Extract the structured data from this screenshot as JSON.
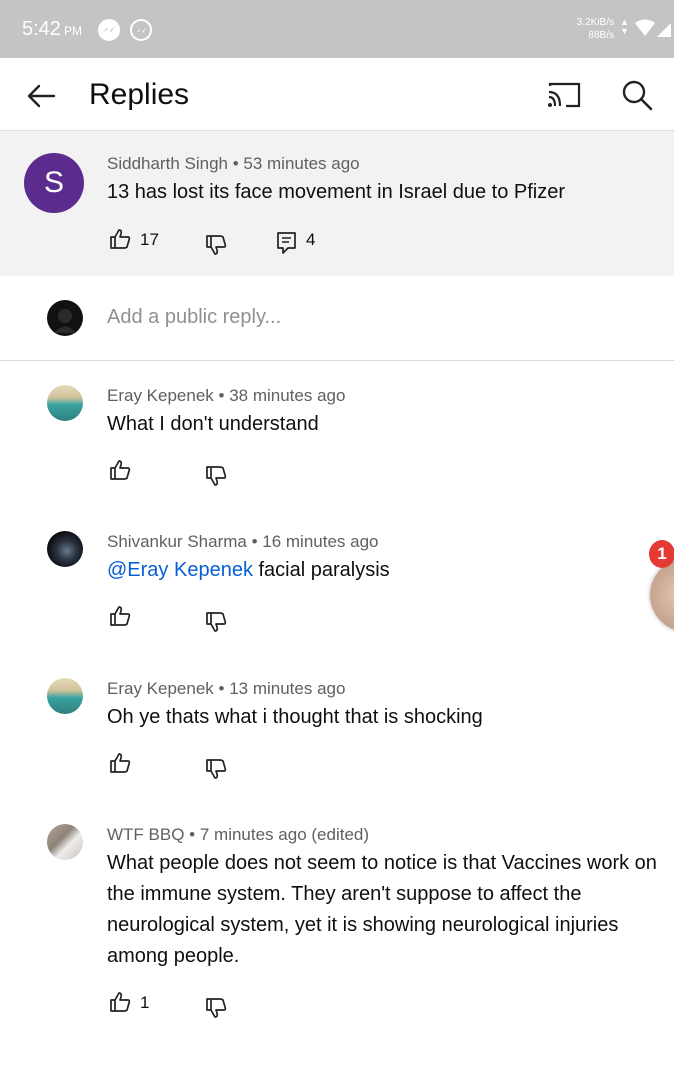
{
  "status_bar": {
    "time": "5:42",
    "ampm": "PM",
    "net_up": "3.2KiB/s",
    "net_down": "88B/s",
    "icons": [
      "messenger-icon",
      "messenger-outline-icon",
      "wifi-icon",
      "signal-icon"
    ]
  },
  "app_bar": {
    "title": "Replies",
    "icons": [
      "back-arrow-icon",
      "cast-icon",
      "search-icon"
    ]
  },
  "parent_comment": {
    "avatar_letter": "S",
    "avatar_color": "#5b2c8e",
    "author": "Siddharth Singh",
    "time": "53 minutes ago",
    "text": "13 has lost its face movement in Israel due to Pfizer",
    "likes": "17",
    "replies": "4"
  },
  "reply_box": {
    "placeholder": "Add a public reply..."
  },
  "replies": [
    {
      "author": "Eray Kepenek",
      "time": "38 minutes ago",
      "text": "What I don't understand"
    },
    {
      "author": "Shivankur Sharma",
      "time": "16 minutes ago",
      "mention": "@Eray Kepenek",
      "text": "facial paralysis"
    },
    {
      "author": "Eray Kepenek",
      "time": "13 minutes ago",
      "text": "Oh ye thats what i thought that is shocking"
    },
    {
      "author": "WTF BBQ",
      "time": "7 minutes ago (edited)",
      "text": "What people does not seem to notice is that  Vaccines work on the immune system.  They aren't suppose to affect the neurological system,  yet it is showing neurological injuries among people.",
      "likes": "1"
    }
  ],
  "chat_head": {
    "badge": "1"
  },
  "colors": {
    "mention": "#065fd4",
    "status_bar": "#c4c4c4",
    "badge": "#e53935"
  }
}
